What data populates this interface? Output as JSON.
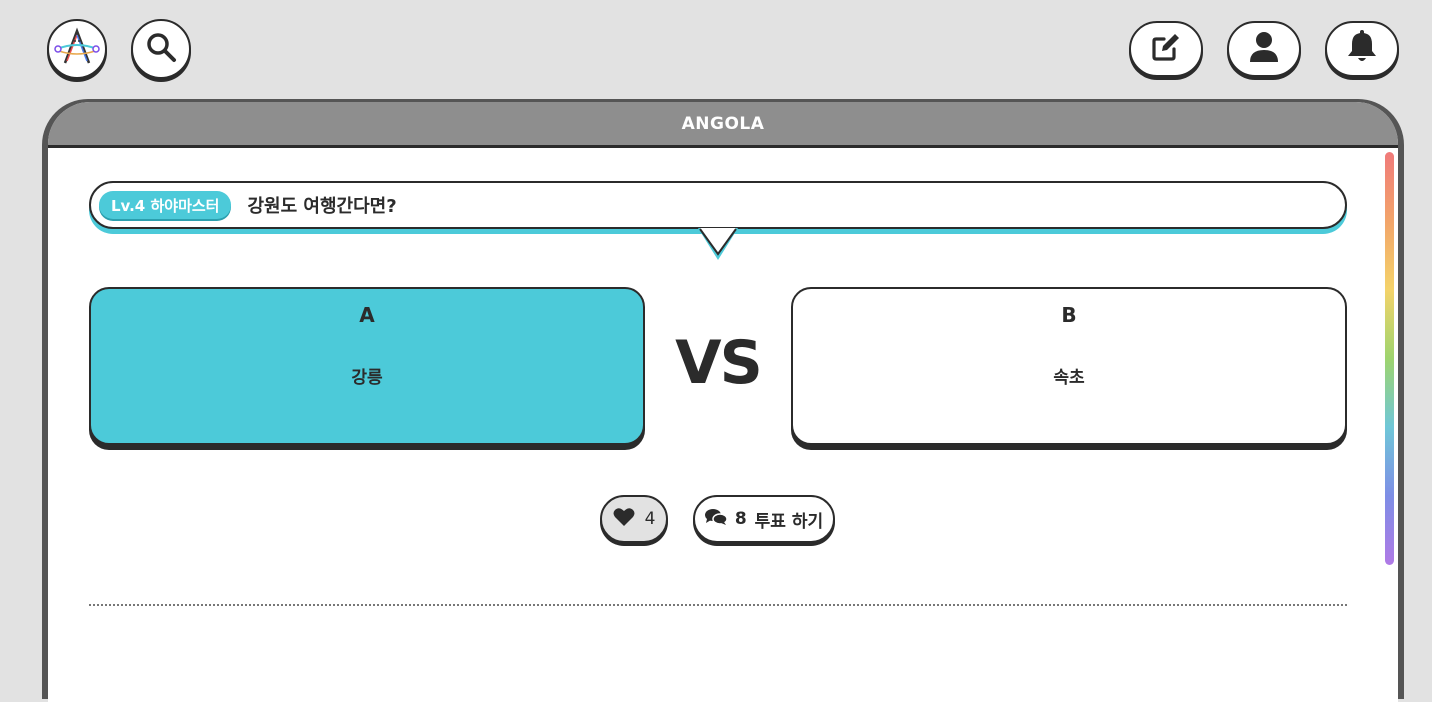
{
  "topbar": {
    "logo_icon": "logo-icon",
    "search_icon": "search-icon",
    "write_icon": "pencil-square-icon",
    "profile_icon": "user-icon",
    "notification_icon": "bell-icon"
  },
  "card": {
    "title": "ANGOLA",
    "question": {
      "level_badge": "Lv.4 하야마스터",
      "text": "강원도 여행간다면?"
    },
    "options": [
      {
        "letter": "A",
        "label": "강릉",
        "selected": true
      },
      {
        "letter": "B",
        "label": "속초",
        "selected": false
      }
    ],
    "vs_label": "VS",
    "likes": {
      "count": "4",
      "icon": "heart-icon"
    },
    "comments": {
      "count": "8",
      "label": "투표 하기",
      "icon": "comments-icon"
    }
  },
  "colors": {
    "accent": "#4ccad9",
    "background": "#e2e2e2",
    "header": "#8e8e8e",
    "outline": "#2b2b2b"
  }
}
